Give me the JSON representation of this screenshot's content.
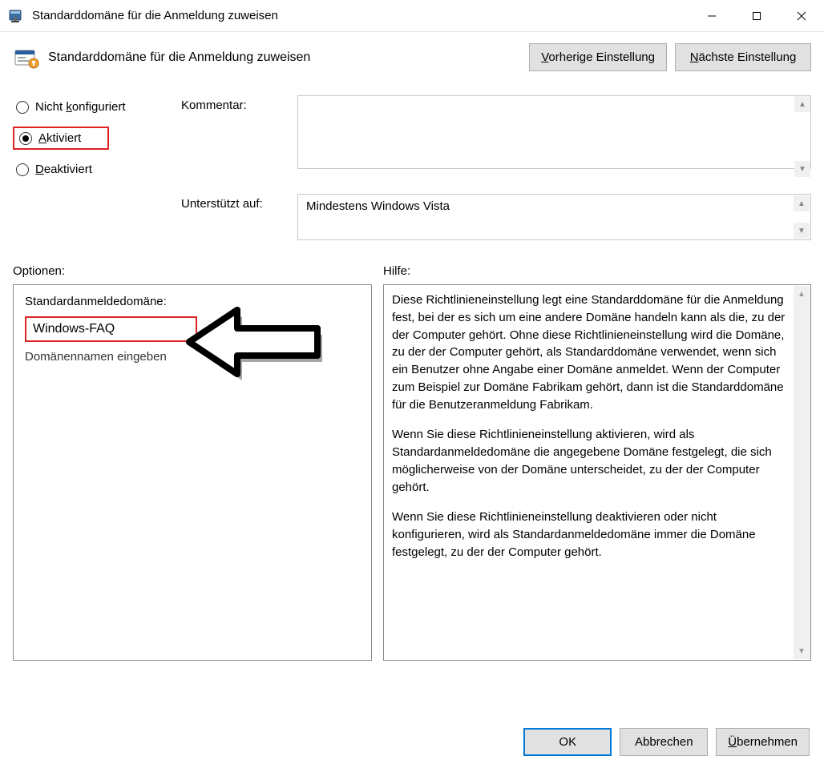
{
  "window": {
    "title": "Standarddomäne für die Anmeldung zuweisen"
  },
  "header": {
    "title": "Standarddomäne für die Anmeldung zuweisen",
    "prevButton": "Vorherige Einstellung",
    "nextButton": "Nächste Einstellung"
  },
  "state": {
    "radios": {
      "notConfigured": "Nicht konfiguriert",
      "enabled": "Aktiviert",
      "disabled": "Deaktiviert",
      "selected": "enabled"
    },
    "commentLabel": "Kommentar:",
    "commentValue": "",
    "supportedLabel": "Unterstützt auf:",
    "supportedValue": "Mindestens Windows Vista"
  },
  "sections": {
    "optionsLabel": "Optionen:",
    "helpLabel": "Hilfe:"
  },
  "options": {
    "fieldLabel": "Standardanmeldedomäne:",
    "fieldValue": "Windows-FAQ",
    "hint": "Domänennamen eingeben"
  },
  "help": {
    "p1": "Diese Richtlinieneinstellung legt eine Standarddomäne für die Anmeldung fest, bei der es sich um eine andere Domäne handeln kann als die, zu der der Computer gehört. Ohne diese Richtlinieneinstellung wird die Domäne, zu der der Computer gehört, als Standarddomäne verwendet, wenn sich ein Benutzer ohne Angabe einer Domäne anmeldet. Wenn der Computer zum Beispiel zur Domäne Fabrikam gehört, dann ist die Standarddomäne für die Benutzeranmeldung Fabrikam.",
    "p2": "Wenn Sie diese Richtlinieneinstellung aktivieren, wird als Standardanmeldedomäne die angegebene Domäne festgelegt, die sich möglicherweise von der Domäne unterscheidet, zu der der Computer gehört.",
    "p3": "Wenn Sie diese Richtlinieneinstellung deaktivieren oder nicht konfigurieren, wird als Standardanmeldedomäne immer die Domäne festgelegt, zu der der Computer gehört."
  },
  "footer": {
    "ok": "OK",
    "cancel": "Abbrechen",
    "apply": "Übernehmen"
  }
}
